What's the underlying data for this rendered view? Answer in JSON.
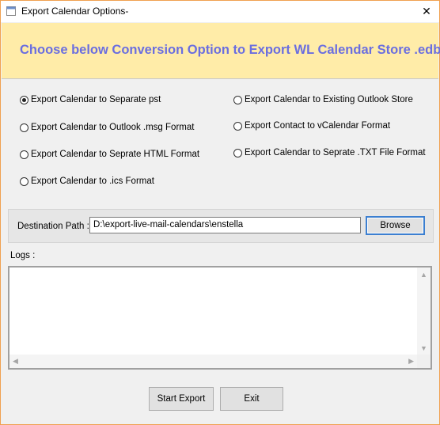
{
  "window": {
    "title": "Export Calendar Options-",
    "close_symbol": "✕"
  },
  "header": {
    "heading": "Choose below Conversion Option to Export WL Calendar Store .edb"
  },
  "options": {
    "left": [
      {
        "label": "Export Calendar to Separate pst",
        "checked": true
      },
      {
        "label": "Export Calendar to Outlook .msg Format",
        "checked": false
      },
      {
        "label": "Export Calendar to Seprate HTML Format",
        "checked": false
      },
      {
        "label": "Export Calendar to .ics Format",
        "checked": false
      }
    ],
    "right": [
      {
        "label": "Export Calendar to Existing Outlook Store",
        "checked": false
      },
      {
        "label": "Export Contact to vCalendar Format",
        "checked": false
      },
      {
        "label": "Export Calendar to Seprate .TXT File Format",
        "checked": false
      }
    ]
  },
  "destination": {
    "label": "Destination Path :",
    "value": "D:\\export-live-mail-calendars\\enstella",
    "browse_label": "Browse"
  },
  "logs": {
    "label": "Logs :",
    "content": ""
  },
  "footer": {
    "start_label": "Start Export",
    "exit_label": "Exit"
  }
}
